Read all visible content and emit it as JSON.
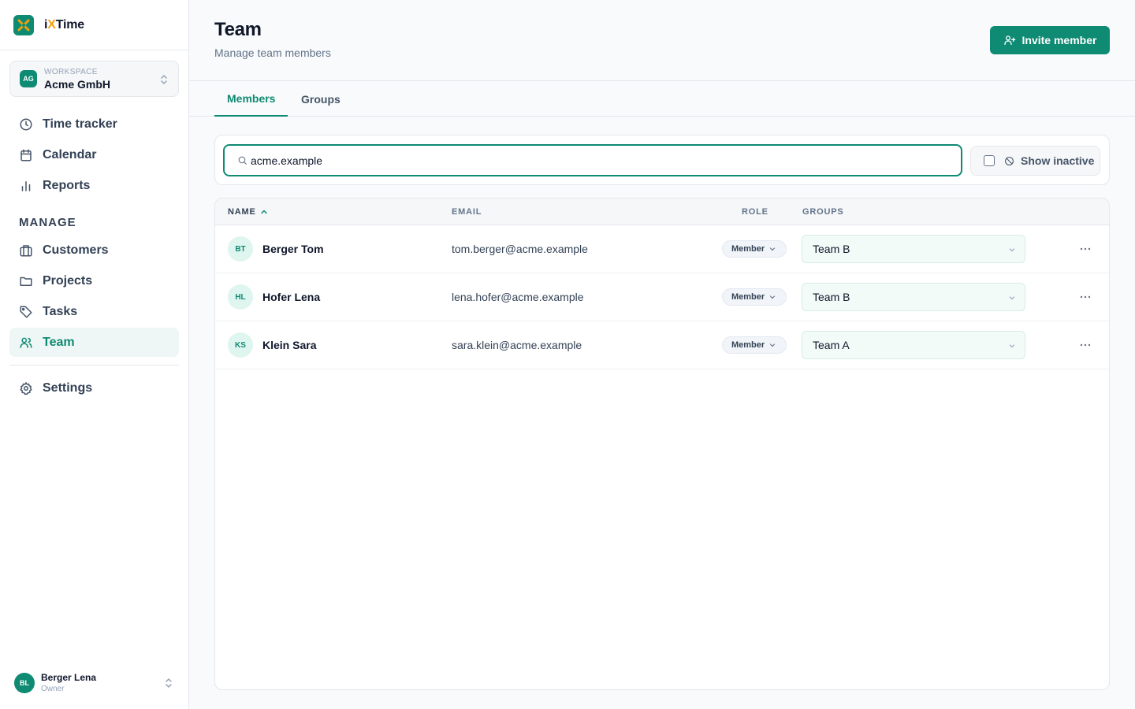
{
  "brand": {
    "name_prefix": "i",
    "name_x": "X",
    "name_suffix": "Time"
  },
  "workspace": {
    "label": "WORKSPACE",
    "name": "Acme GmbH",
    "initials": "AG"
  },
  "nav": {
    "items": [
      {
        "label": "Time tracker",
        "icon": "clock-icon"
      },
      {
        "label": "Calendar",
        "icon": "calendar-icon"
      },
      {
        "label": "Reports",
        "icon": "bar-chart-icon"
      }
    ],
    "section_label": "MANAGE",
    "manage_items": [
      {
        "label": "Customers",
        "icon": "building-icon"
      },
      {
        "label": "Projects",
        "icon": "folder-icon"
      },
      {
        "label": "Tasks",
        "icon": "tag-icon"
      },
      {
        "label": "Team",
        "icon": "users-icon",
        "active": true
      }
    ],
    "settings": {
      "label": "Settings",
      "icon": "gear-icon"
    }
  },
  "user": {
    "initials": "BL",
    "name": "Berger Lena",
    "role": "Owner"
  },
  "header": {
    "title": "Team",
    "subtitle": "Manage team members",
    "invite_label": "Invite member"
  },
  "tabs": [
    {
      "label": "Members",
      "active": true
    },
    {
      "label": "Groups",
      "active": false
    }
  ],
  "filter": {
    "search_value": "acme.example",
    "show_inactive_label": "Show inactive",
    "show_inactive_checked": false
  },
  "table": {
    "columns": {
      "name": "NAME",
      "email": "EMAIL",
      "role": "ROLE",
      "groups": "GROUPS"
    },
    "rows": [
      {
        "initials": "BT",
        "name": "Berger Tom",
        "email": "tom.berger@acme.example",
        "role": "Member",
        "group": "Team B"
      },
      {
        "initials": "HL",
        "name": "Hofer Lena",
        "email": "lena.hofer@acme.example",
        "role": "Member",
        "group": "Team B"
      },
      {
        "initials": "KS",
        "name": "Klein Sara",
        "email": "sara.klein@acme.example",
        "role": "Member",
        "group": "Team A"
      }
    ]
  },
  "colors": {
    "accent": "#0f8a73",
    "logo_x": "#f59e0b",
    "active_bg": "#eef7f5"
  }
}
